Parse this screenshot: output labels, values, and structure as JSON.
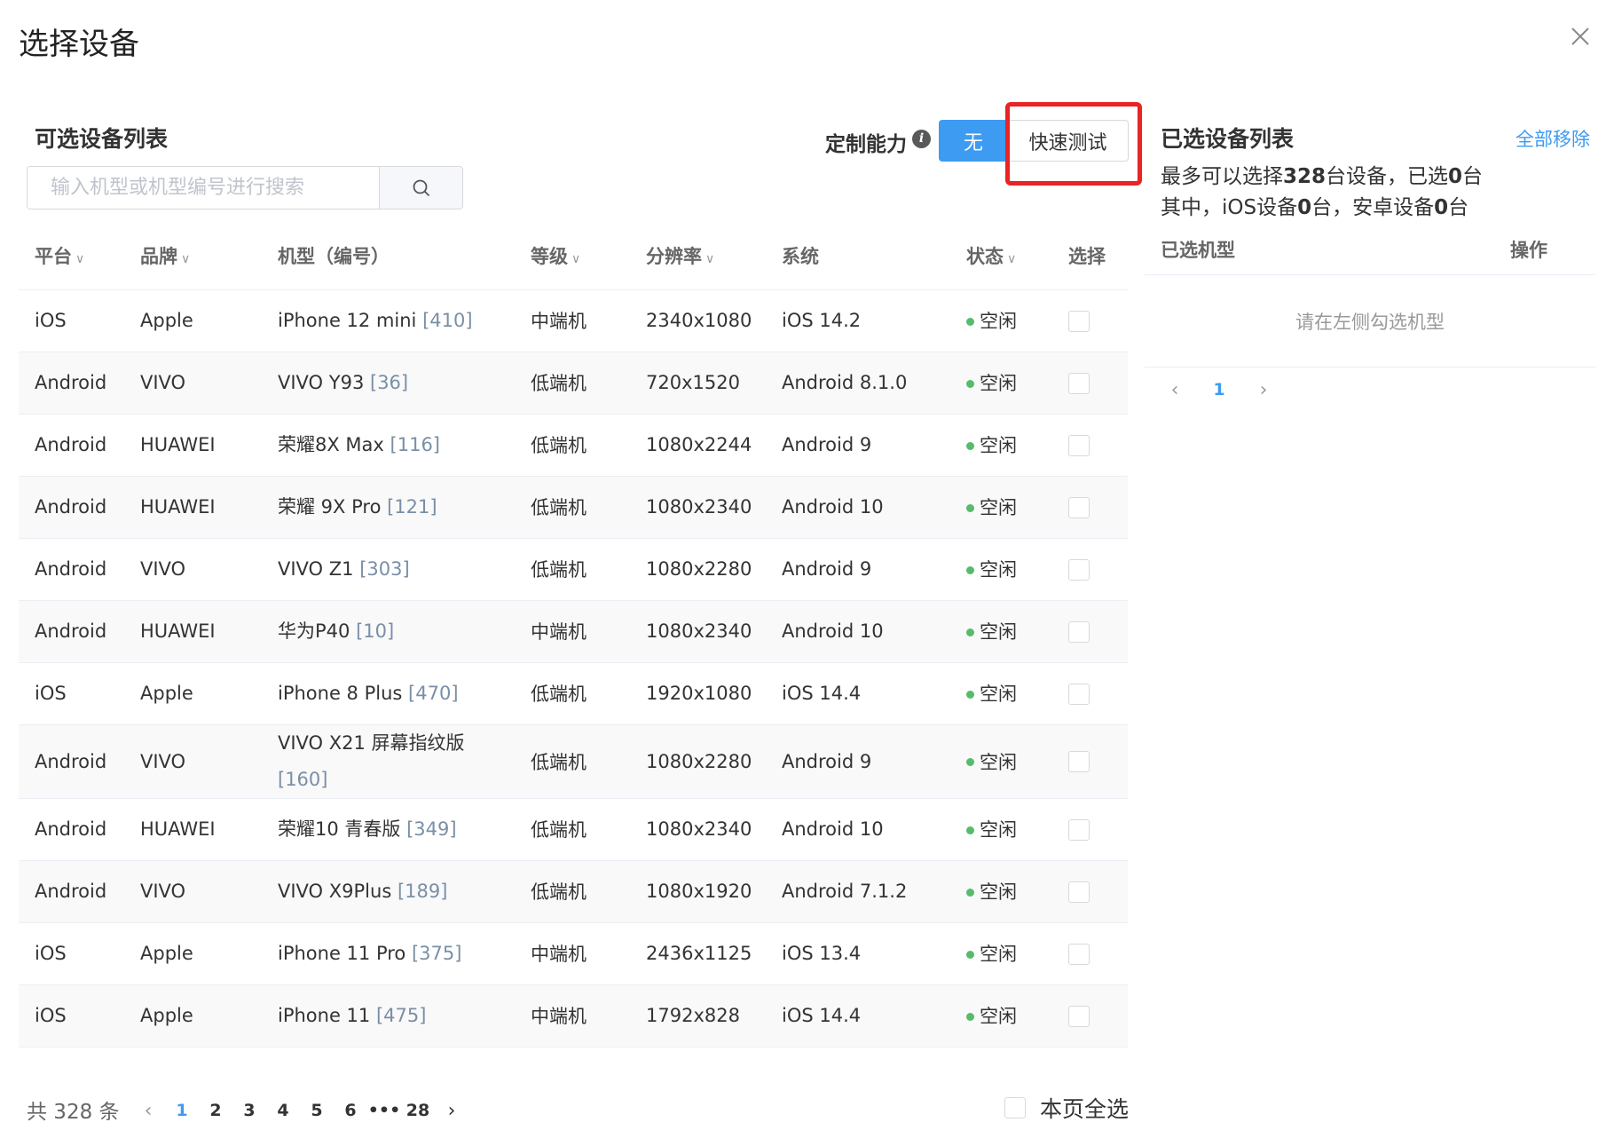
{
  "dialog": {
    "title": "选择设备"
  },
  "left": {
    "title": "可选设备列表",
    "search_placeholder": "输入机型或机型编号进行搜索"
  },
  "custom": {
    "label": "定制能力",
    "info_icon": "i",
    "options": [
      "无",
      "快速测试"
    ],
    "selected": "无"
  },
  "table": {
    "headers": {
      "platform": "平台",
      "brand": "品牌",
      "model": "机型（编号）",
      "level": "等级",
      "resolution": "分辨率",
      "system": "系统",
      "status": "状态",
      "select": "选择"
    },
    "rows": [
      {
        "platform": "iOS",
        "brand": "Apple",
        "model": "iPhone 12 mini",
        "code": "[410]",
        "level": "中端机",
        "resolution": "2340x1080",
        "system": "iOS 14.2",
        "status": "空闲"
      },
      {
        "platform": "Android",
        "brand": "VIVO",
        "model": "VIVO Y93",
        "code": "[36]",
        "level": "低端机",
        "resolution": "720x1520",
        "system": "Android 8.1.0",
        "status": "空闲"
      },
      {
        "platform": "Android",
        "brand": "HUAWEI",
        "model": "荣耀8X Max",
        "code": "[116]",
        "level": "低端机",
        "resolution": "1080x2244",
        "system": "Android 9",
        "status": "空闲"
      },
      {
        "platform": "Android",
        "brand": "HUAWEI",
        "model": "荣耀 9X Pro",
        "code": "[121]",
        "level": "低端机",
        "resolution": "1080x2340",
        "system": "Android 10",
        "status": "空闲"
      },
      {
        "platform": "Android",
        "brand": "VIVO",
        "model": "VIVO Z1",
        "code": "[303]",
        "level": "低端机",
        "resolution": "1080x2280",
        "system": "Android 9",
        "status": "空闲"
      },
      {
        "platform": "Android",
        "brand": "HUAWEI",
        "model": "华为P40",
        "code": "[10]",
        "level": "中端机",
        "resolution": "1080x2340",
        "system": "Android 10",
        "status": "空闲"
      },
      {
        "platform": "iOS",
        "brand": "Apple",
        "model": "iPhone 8 Plus",
        "code": "[470]",
        "level": "低端机",
        "resolution": "1920x1080",
        "system": "iOS 14.4",
        "status": "空闲"
      },
      {
        "platform": "Android",
        "brand": "VIVO",
        "model": "VIVO X21 屏幕指纹版",
        "code": "[160]",
        "level": "低端机",
        "resolution": "1080x2280",
        "system": "Android 9",
        "status": "空闲"
      },
      {
        "platform": "Android",
        "brand": "HUAWEI",
        "model": "荣耀10 青春版",
        "code": "[349]",
        "level": "低端机",
        "resolution": "1080x2340",
        "system": "Android 10",
        "status": "空闲"
      },
      {
        "platform": "Android",
        "brand": "VIVO",
        "model": "VIVO X9Plus",
        "code": "[189]",
        "level": "低端机",
        "resolution": "1080x1920",
        "system": "Android 7.1.2",
        "status": "空闲"
      },
      {
        "platform": "iOS",
        "brand": "Apple",
        "model": "iPhone 11 Pro",
        "code": "[375]",
        "level": "中端机",
        "resolution": "2436x1125",
        "system": "iOS 13.4",
        "status": "空闲"
      },
      {
        "platform": "iOS",
        "brand": "Apple",
        "model": "iPhone 11",
        "code": "[475]",
        "level": "中端机",
        "resolution": "1792x828",
        "system": "iOS 14.4",
        "status": "空闲"
      }
    ]
  },
  "pagination": {
    "total": "共 328 条",
    "pages": [
      "1",
      "2",
      "3",
      "4",
      "5",
      "6",
      "•••",
      "28"
    ],
    "current": "1",
    "select_all": "本页全选"
  },
  "right": {
    "title": "已选设备列表",
    "remove_all": "全部移除",
    "info_prefix": "最多可以选择",
    "max_count": "328",
    "info_mid": "台设备，已选",
    "selected_count": "0",
    "info_suffix": "台",
    "breakdown_prefix": "其中，iOS设备",
    "ios_count": "0",
    "breakdown_mid": "台，安卓设备",
    "android_count": "0",
    "breakdown_suffix": "台",
    "col_model": "已选机型",
    "col_action": "操作",
    "empty_text": "请在左侧勾选机型",
    "page": "1"
  },
  "colors": {
    "primary": "#3d9bf2",
    "status_idle": "#55bc6b",
    "highlight": "#e82424",
    "code_text": "#7a8fa6"
  }
}
